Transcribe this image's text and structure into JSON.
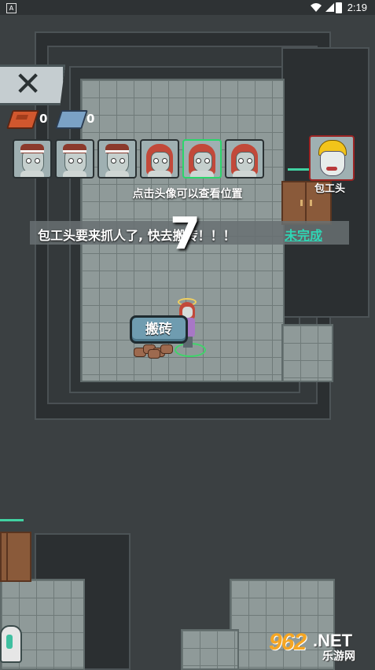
{
  "status_bar": {
    "time": "2:19",
    "app_icon": "A"
  },
  "resources": {
    "brick_count": "0",
    "steel_count": "0"
  },
  "players": [
    {
      "type": "male",
      "selected": false
    },
    {
      "type": "male",
      "selected": false
    },
    {
      "type": "male",
      "selected": false
    },
    {
      "type": "female",
      "selected": false
    },
    {
      "type": "female",
      "selected": true
    },
    {
      "type": "female",
      "selected": false
    }
  ],
  "boss": {
    "label": "包工头"
  },
  "hint": "点击头像可以查看位置",
  "task": {
    "text": "包工头要来抓人了, 快去搬砖！！！",
    "status": "未完成"
  },
  "countdown": "7",
  "action_button": "搬砖",
  "watermark": {
    "number": "962",
    "suffix": ".NET",
    "cn": "乐游网"
  },
  "colors": {
    "accent": "#2fd6b5",
    "selected_border": "#2bd66b",
    "boss_border": "#9c2424",
    "door_bar": "#41d2a2"
  }
}
